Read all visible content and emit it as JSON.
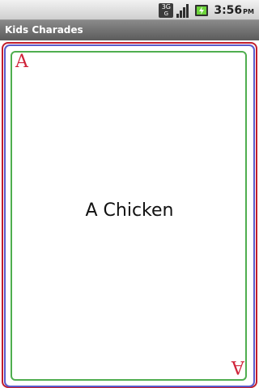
{
  "status_bar": {
    "network_badge_top": "3G",
    "network_badge_bottom": "G",
    "icons": [
      "network-3g-icon",
      "signal-bars-icon",
      "battery-charging-icon"
    ],
    "time": "3:56",
    "ampm": "PM"
  },
  "app": {
    "title": "Kids Charades"
  },
  "card": {
    "corner_top": "A",
    "corner_bottom": "A",
    "text": "A Chicken",
    "colors": {
      "outer_border": "#c21f2c",
      "middle_border": "#5a5acb",
      "inner_border": "#4fae4f",
      "corner_letter": "#d0243a"
    }
  }
}
